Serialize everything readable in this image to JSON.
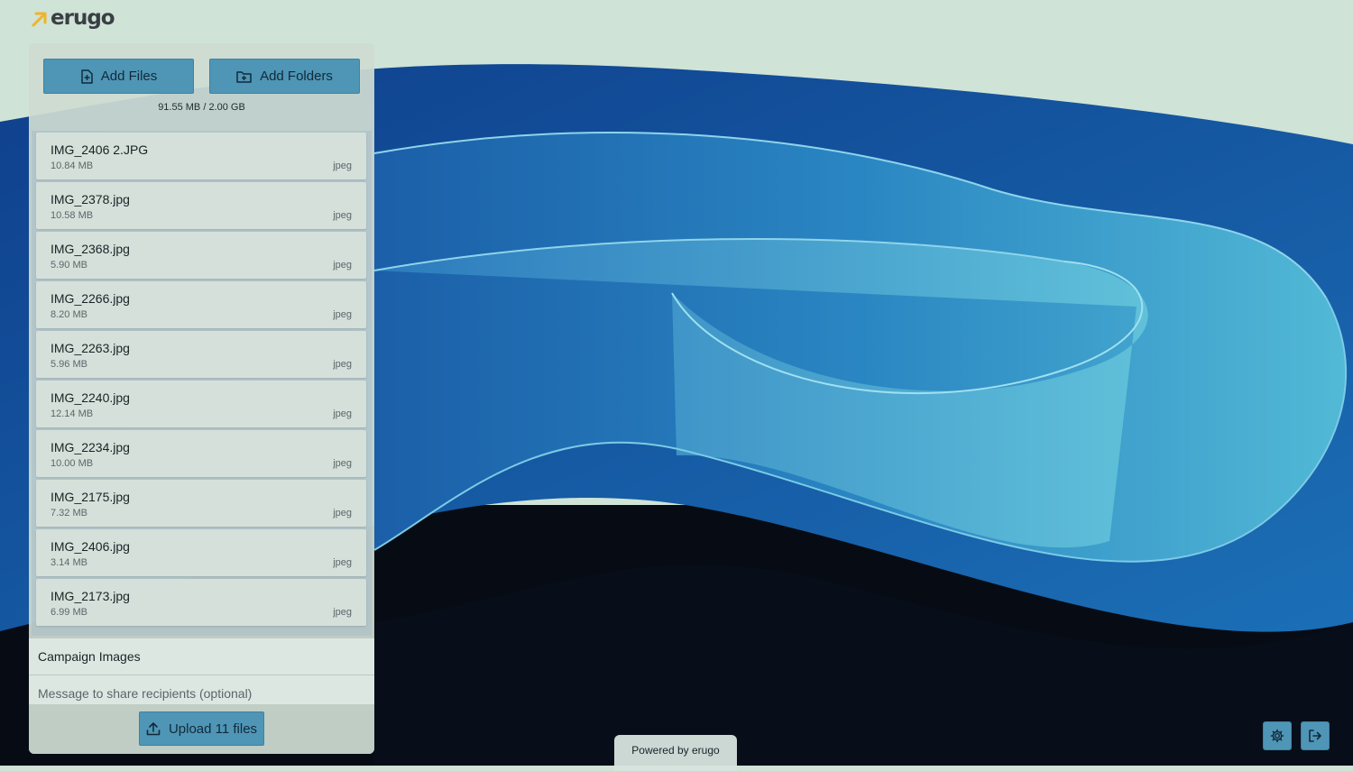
{
  "brand": {
    "name": "erugo",
    "accent_color": "#f0b429",
    "text_color": "#3a3f44"
  },
  "toolbar": {
    "add_files_label": "Add Files",
    "add_files_icon": "file-plus-icon",
    "add_folders_label": "Add Folders",
    "add_folders_icon": "folder-plus-icon"
  },
  "quota": {
    "text": "91.55 MB / 2.00 GB"
  },
  "files": [
    {
      "name": "IMG_2406 2.JPG",
      "size": "10.84 MB",
      "type": "jpeg"
    },
    {
      "name": "IMG_2378.jpg",
      "size": "10.58 MB",
      "type": "jpeg"
    },
    {
      "name": "IMG_2368.jpg",
      "size": "5.90 MB",
      "type": "jpeg"
    },
    {
      "name": "IMG_2266.jpg",
      "size": "8.20 MB",
      "type": "jpeg"
    },
    {
      "name": "IMG_2263.jpg",
      "size": "5.96 MB",
      "type": "jpeg"
    },
    {
      "name": "IMG_2240.jpg",
      "size": "12.14 MB",
      "type": "jpeg"
    },
    {
      "name": "IMG_2234.jpg",
      "size": "10.00 MB",
      "type": "jpeg"
    },
    {
      "name": "IMG_2175.jpg",
      "size": "7.32 MB",
      "type": "jpeg"
    },
    {
      "name": "IMG_2406.jpg",
      "size": "3.14 MB",
      "type": "jpeg"
    },
    {
      "name": "IMG_2173.jpg",
      "size": "6.99 MB",
      "type": "jpeg"
    }
  ],
  "share": {
    "name_value": "Campaign Images",
    "message_placeholder": "Message to share recipients (optional)"
  },
  "upload": {
    "label": "Upload 11 files",
    "icon": "upload-icon"
  },
  "footer": {
    "powered_by": "Powered by erugo"
  },
  "corner_buttons": {
    "settings_icon": "gear-icon",
    "logout_icon": "logout-icon"
  },
  "colors": {
    "button": "#4f95b6",
    "panel": "#cddbd2"
  }
}
